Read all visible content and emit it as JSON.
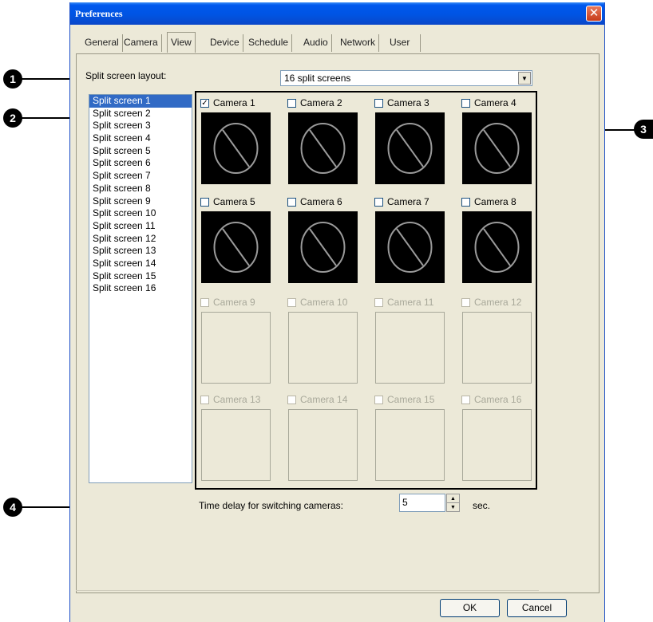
{
  "window": {
    "title": "Preferences",
    "close_glyph": "✕"
  },
  "tabs": [
    "General",
    "Camera",
    "View",
    "Device",
    "Schedule",
    "Audio",
    "Network",
    "User"
  ],
  "active_tab": "View",
  "layout": {
    "label": "Split screen layout:",
    "value": "16 split screens"
  },
  "split_screens": [
    "Split screen 1",
    "Split screen 2",
    "Split screen 3",
    "Split screen 4",
    "Split screen 5",
    "Split screen 6",
    "Split screen 7",
    "Split screen 8",
    "Split screen 9",
    "Split screen 10",
    "Split screen 11",
    "Split screen 12",
    "Split screen 13",
    "Split screen 14",
    "Split screen 15",
    "Split screen 16"
  ],
  "selected_split_screen": "Split screen 1",
  "cameras": [
    {
      "label": "Camera 1",
      "checked": true,
      "enabled": true
    },
    {
      "label": "Camera 2",
      "checked": false,
      "enabled": true
    },
    {
      "label": "Camera 3",
      "checked": false,
      "enabled": true
    },
    {
      "label": "Camera 4",
      "checked": false,
      "enabled": true
    },
    {
      "label": "Camera 5",
      "checked": false,
      "enabled": true
    },
    {
      "label": "Camera 6",
      "checked": false,
      "enabled": true
    },
    {
      "label": "Camera 7",
      "checked": false,
      "enabled": true
    },
    {
      "label": "Camera 8",
      "checked": false,
      "enabled": true
    },
    {
      "label": "Camera 9",
      "checked": false,
      "enabled": false
    },
    {
      "label": "Camera 10",
      "checked": false,
      "enabled": false
    },
    {
      "label": "Camera 11",
      "checked": false,
      "enabled": false
    },
    {
      "label": "Camera 12",
      "checked": false,
      "enabled": false
    },
    {
      "label": "Camera 13",
      "checked": false,
      "enabled": false
    },
    {
      "label": "Camera 14",
      "checked": false,
      "enabled": false
    },
    {
      "label": "Camera 15",
      "checked": false,
      "enabled": false
    },
    {
      "label": "Camera 16",
      "checked": false,
      "enabled": false
    }
  ],
  "delay": {
    "label": "Time delay for switching cameras:",
    "value": "5",
    "unit": "sec."
  },
  "buttons": {
    "ok": "OK",
    "cancel": "Cancel"
  },
  "callouts": [
    "1",
    "2",
    "3",
    "4"
  ],
  "icons": {
    "no_video": "no-signal-icon",
    "dropdown": "chevron-down-icon",
    "spin_up": "spin-up-icon",
    "spin_down": "spin-down-icon"
  },
  "colors": {
    "selection": "#316ac5",
    "dialog_bg": "#ece9d8",
    "title_bar": "#0054e3"
  }
}
